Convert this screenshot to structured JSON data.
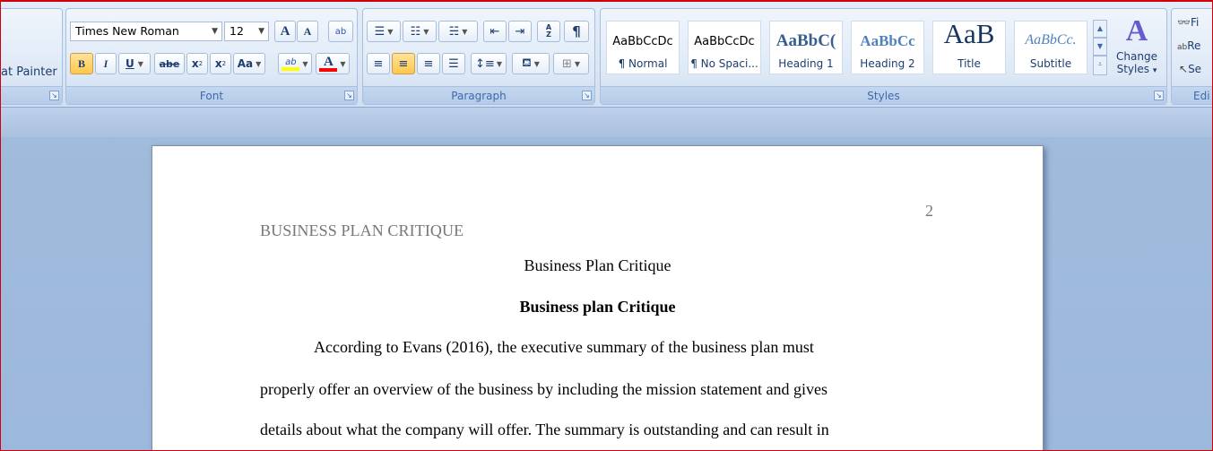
{
  "clipboard": {
    "format_painter_label": "at Painter",
    "group_label": ""
  },
  "font": {
    "font_name": "Times New Roman",
    "font_size": "12",
    "grow_label": "A",
    "shrink_label": "A",
    "clear_label": "ab",
    "bold_label": "B",
    "italic_label": "I",
    "underline_label": "U",
    "strike_label": "abe",
    "subscript_label": "x",
    "superscript_label": "x",
    "change_case_label": "Aa",
    "highlight_label": "ab",
    "font_color_label": "A",
    "group_label": "Font"
  },
  "paragraph": {
    "group_label": "Paragraph",
    "sort_label": "A Z",
    "pilcrow": "¶"
  },
  "styles": {
    "group_label": "Styles",
    "tiles": [
      {
        "preview": "AaBbCcDc",
        "name": "¶ Normal"
      },
      {
        "preview": "AaBbCcDc",
        "name": "¶ No Spaci..."
      },
      {
        "preview": "AaBbC(",
        "name": "Heading 1"
      },
      {
        "preview": "AaBbCc",
        "name": "Heading 2"
      },
      {
        "preview": "AaB",
        "name": "Title"
      },
      {
        "preview": "AaBbCc.",
        "name": "Subtitle"
      }
    ],
    "change_styles_line1": "Change",
    "change_styles_line2": "Styles",
    "dropdown_arrow": "▾"
  },
  "editing": {
    "group_label": "Edi",
    "find_label": "Fi",
    "replace_label": "Re",
    "select_label": "Se"
  },
  "document": {
    "page_number": "2",
    "running_head": "BUSINESS PLAN CRITIQUE",
    "title": "Business Plan Critique",
    "heading": "Business plan Critique",
    "lines": [
      "According to Evans (2016), the executive summary of the business plan must",
      "properly offer an overview of the business by including the mission statement and gives",
      "details about what the company will offer. The summary is outstanding and can result in"
    ]
  },
  "colors": {
    "accent": "#15428b",
    "highlight_yellow": "#ffff00",
    "font_red": "#ff0000",
    "heading_blue": "#365f91",
    "border_red": "#d0000a"
  }
}
